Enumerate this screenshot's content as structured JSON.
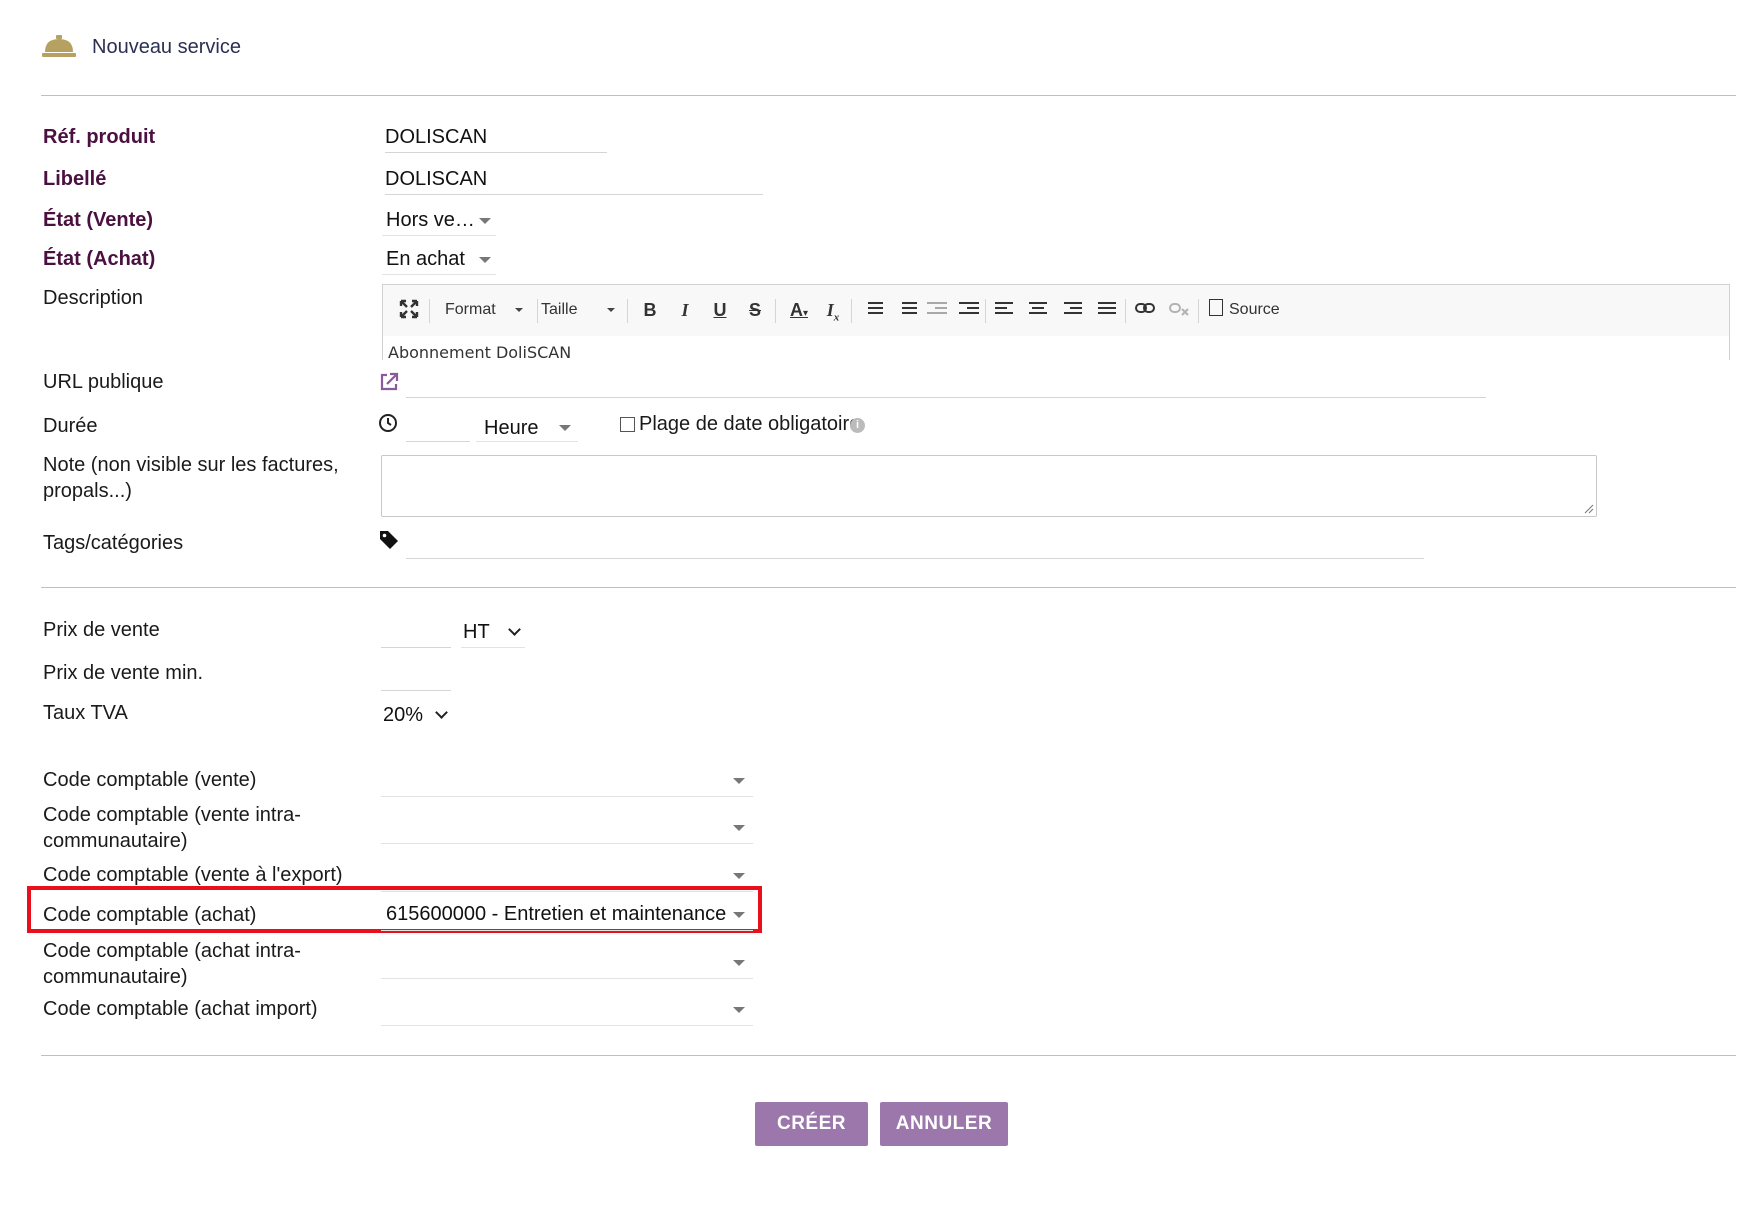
{
  "header": {
    "title": "Nouveau service",
    "icon": "service-bell-icon"
  },
  "fields": {
    "ref": {
      "label": "Réf. produit",
      "value": "DOLISCAN"
    },
    "libelle": {
      "label": "Libellé",
      "value": "DOLISCAN"
    },
    "etat_vente": {
      "label": "État (Vente)",
      "value": "Hors ve…"
    },
    "etat_achat": {
      "label": "État (Achat)",
      "value": "En achat"
    },
    "description": {
      "label": "Description",
      "value": "Abonnement DoliSCAN"
    },
    "url": {
      "label": "URL publique",
      "value": ""
    },
    "duree": {
      "label": "Durée",
      "unit": "Heure",
      "date_range_label": "Plage de date obligatoire"
    },
    "note": {
      "label_line1": "Note (non visible sur les factures,",
      "label_line2": "propals...)"
    },
    "tags": {
      "label": "Tags/catégories"
    }
  },
  "editor_toolbar": {
    "format": "Format",
    "size": "Taille",
    "source": "Source"
  },
  "pricing": {
    "prix_vente": {
      "label": "Prix de vente",
      "tax_mode": "HT"
    },
    "prix_min": {
      "label": "Prix de vente min."
    },
    "tva": {
      "label": "Taux TVA",
      "value": "20%"
    }
  },
  "accounting": {
    "vente": {
      "label": "Code comptable (vente)",
      "value": ""
    },
    "vente_intra": {
      "label_line1": "Code comptable (vente intra-",
      "label_line2": "communautaire)",
      "value": ""
    },
    "vente_export": {
      "label": "Code comptable (vente à l'export)",
      "value": ""
    },
    "achat": {
      "label": "Code comptable (achat)",
      "value": "615600000 - Entretien et maintenance"
    },
    "achat_intra": {
      "label_line1": "Code comptable (achat intra-",
      "label_line2": "communautaire)",
      "value": ""
    },
    "achat_import": {
      "label": "Code comptable (achat import)",
      "value": ""
    }
  },
  "actions": {
    "create": "CRÉER",
    "cancel": "ANNULER"
  },
  "colors": {
    "accent": "#9b77ab",
    "required_label": "#4a1040",
    "highlight": "#e8101b",
    "icon_gold": "#b6a160"
  }
}
